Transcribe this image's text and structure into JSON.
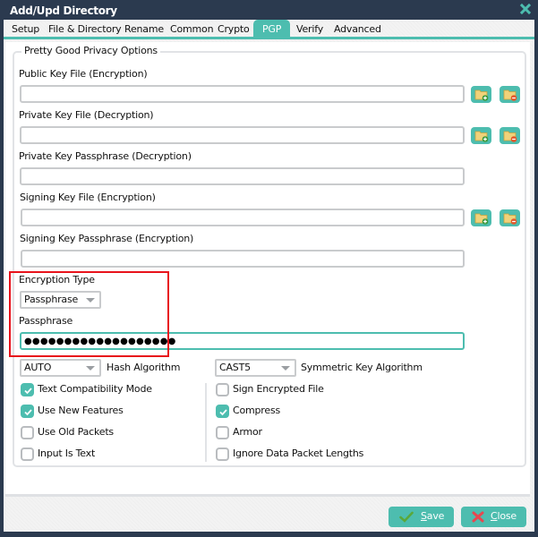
{
  "window": {
    "title": "Add/Upd Directory"
  },
  "tabs": [
    {
      "label": "Setup",
      "active": false
    },
    {
      "label": "File & Directory",
      "active": false
    },
    {
      "label": "Rename",
      "active": false
    },
    {
      "label": "Common",
      "active": false
    },
    {
      "label": "Crypto",
      "active": false
    },
    {
      "label": "PGP",
      "active": true
    },
    {
      "label": "Verify",
      "active": false
    },
    {
      "label": "Advanced",
      "active": false
    }
  ],
  "group": {
    "legend": "Pretty Good Privacy Options"
  },
  "fields": {
    "public_key_file": {
      "label": "Public Key File (Encryption)",
      "value": ""
    },
    "private_key_file": {
      "label": "Private Key File (Decryption)",
      "value": ""
    },
    "private_key_passphrase": {
      "label": "Private Key Passphrase (Decryption)",
      "value": ""
    },
    "signing_key_file": {
      "label": "Signing Key File (Encryption)",
      "value": ""
    },
    "signing_key_passphrase": {
      "label": "Signing Key Passphrase (Encryption)",
      "value": ""
    },
    "encryption_type": {
      "label": "Encryption Type",
      "value": "Passphrase"
    },
    "passphrase": {
      "label": "Passphrase",
      "masked_value": "●●●●●●●●●●●●●●●●●●●"
    }
  },
  "file_buttons": {
    "add_icon": "folder-add-icon",
    "remove_icon": "folder-remove-icon"
  },
  "algorithms": {
    "hash": {
      "value": "AUTO",
      "label": "Hash Algorithm"
    },
    "symmetric": {
      "value": "CAST5",
      "label": "Symmetric Key Algorithm"
    }
  },
  "options_left": [
    {
      "label": "Text Compatibility Mode",
      "checked": true
    },
    {
      "label": "Use New Features",
      "checked": true
    },
    {
      "label": "Use Old Packets",
      "checked": false
    },
    {
      "label": "Input Is Text",
      "checked": false
    }
  ],
  "options_right": [
    {
      "label": "Sign Encrypted File",
      "checked": false
    },
    {
      "label": "Compress",
      "checked": true
    },
    {
      "label": "Armor",
      "checked": false
    },
    {
      "label": "Ignore Data Packet Lengths",
      "checked": false
    }
  ],
  "footer": {
    "save_label": "Save",
    "save_mnemonic": "S",
    "save_rest": "ave",
    "close_label": "Close",
    "close_mnemonic": "C",
    "close_rest": "lose"
  },
  "colors": {
    "accent": "#4dbdaf",
    "titlebar": "#2b3a4f",
    "highlight": "#e8131b"
  }
}
